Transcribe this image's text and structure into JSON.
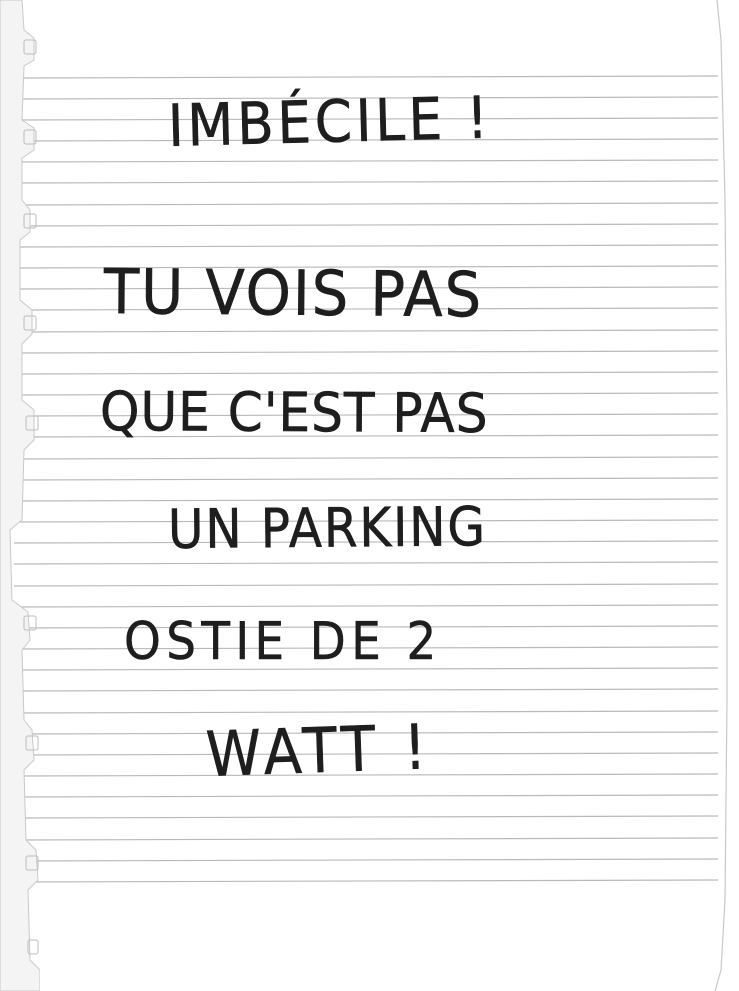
{
  "note": {
    "lines": [
      "IMBÉCILE !",
      "TU VOIS PAS",
      "QUE C'EST PAS",
      "UN PARKING",
      "OSTIE DE 2",
      "WATT !"
    ]
  },
  "colors": {
    "paper": "#ffffff",
    "ruling": "#b9b9b9",
    "ink": "#1e1e1e"
  }
}
